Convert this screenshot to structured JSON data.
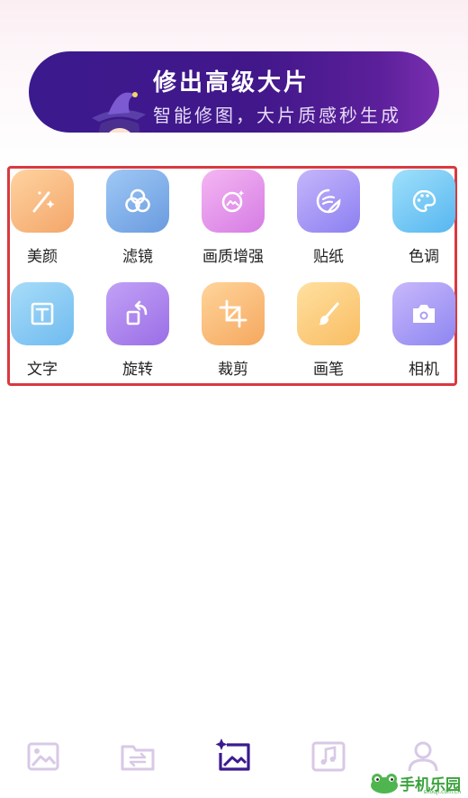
{
  "banner": {
    "title": "修出高级大片",
    "subtitle": "智能修图，大片质感秒生成"
  },
  "tools_row1": [
    {
      "label": "美颜",
      "icon": "magic-wand-icon",
      "color_from": "#ffd3a0",
      "color_to": "#f3a66a"
    },
    {
      "label": "滤镜",
      "icon": "filter-circles-icon",
      "color_from": "#9ec8f5",
      "color_to": "#6a9bdf"
    },
    {
      "label": "画质增强",
      "icon": "image-enhance-icon",
      "color_from": "#f5b6f2",
      "color_to": "#d57ce4"
    },
    {
      "label": "贴纸",
      "icon": "sticker-icon",
      "color_from": "#c6b6fb",
      "color_to": "#8b7ff1"
    },
    {
      "label": "色调",
      "icon": "palette-icon",
      "color_from": "#9fe0fb",
      "color_to": "#56b6f0"
    }
  ],
  "tools_row2": [
    {
      "label": "文字",
      "icon": "text-icon",
      "color_from": "#a8dcf8",
      "color_to": "#6fbbf0"
    },
    {
      "label": "旋转",
      "icon": "rotate-icon",
      "color_from": "#c2a1f6",
      "color_to": "#9a6ee6"
    },
    {
      "label": "裁剪",
      "icon": "crop-icon",
      "color_from": "#ffd49a",
      "color_to": "#f5a85f"
    },
    {
      "label": "画笔",
      "icon": "brush-icon",
      "color_from": "#ffe0a0",
      "color_to": "#f9bd62"
    },
    {
      "label": "相机",
      "icon": "camera-icon",
      "color_from": "#c9b8fb",
      "color_to": "#8d86f1"
    }
  ],
  "bottom_nav": [
    {
      "icon": "gallery-icon",
      "active": false
    },
    {
      "icon": "folder-transfer-icon",
      "active": false
    },
    {
      "icon": "sparkle-image-icon",
      "active": true
    },
    {
      "icon": "music-icon",
      "active": false
    },
    {
      "icon": "profile-icon",
      "active": false
    }
  ],
  "watermark": {
    "text": "手机乐园",
    "sub": "shouji.com.cn"
  },
  "colors": {
    "highlight_border": "#d9393f",
    "banner": "#41178a",
    "nav_inactive": "#c9b8de",
    "nav_active": "#3b1a8e"
  }
}
